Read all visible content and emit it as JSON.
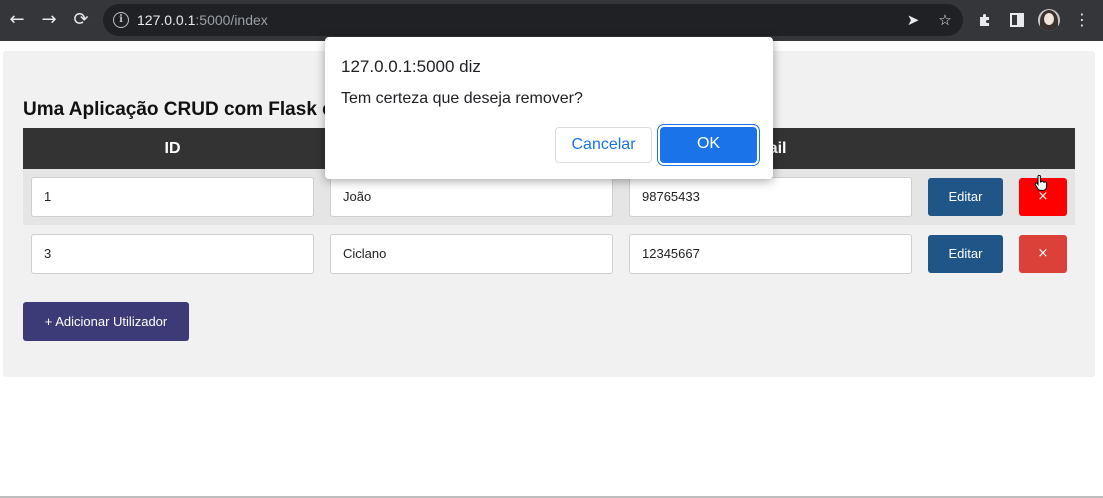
{
  "browser": {
    "url_host": "127.0.0.1",
    "url_rest": ":5000/index",
    "icons": {
      "back": "arrow-left-icon",
      "forward": "arrow-right-icon",
      "reload": "reload-icon",
      "info": "info-icon",
      "send": "send-icon",
      "bookmark": "star-icon",
      "extensions": "puzzle-icon",
      "sidepanel": "side-panel-icon",
      "menu": "kebab-menu-icon"
    }
  },
  "page": {
    "title": "Uma Aplicação CRUD com Flask e",
    "headers": [
      "ID",
      "",
      "mail"
    ],
    "rows": [
      {
        "id": "1",
        "name": "João",
        "phone": "98765433",
        "edit_label": "Editar",
        "delete_label": "×",
        "delete_color": "#ff0000"
      },
      {
        "id": "3",
        "name": "Ciclano",
        "phone": "12345667",
        "edit_label": "Editar",
        "delete_label": "×",
        "delete_color": "#dc4139"
      }
    ],
    "add_button": "+ Adicionar Utilizador"
  },
  "dialog": {
    "title": "127.0.0.1:5000 diz",
    "message": "Tem certeza que deseja remover?",
    "cancel_label": "Cancelar",
    "ok_label": "OK"
  },
  "colors": {
    "header_bg": "#333333",
    "edit_button": "#1f5687",
    "add_button": "#3d3a78",
    "dialog_accent": "#1a73e8"
  }
}
